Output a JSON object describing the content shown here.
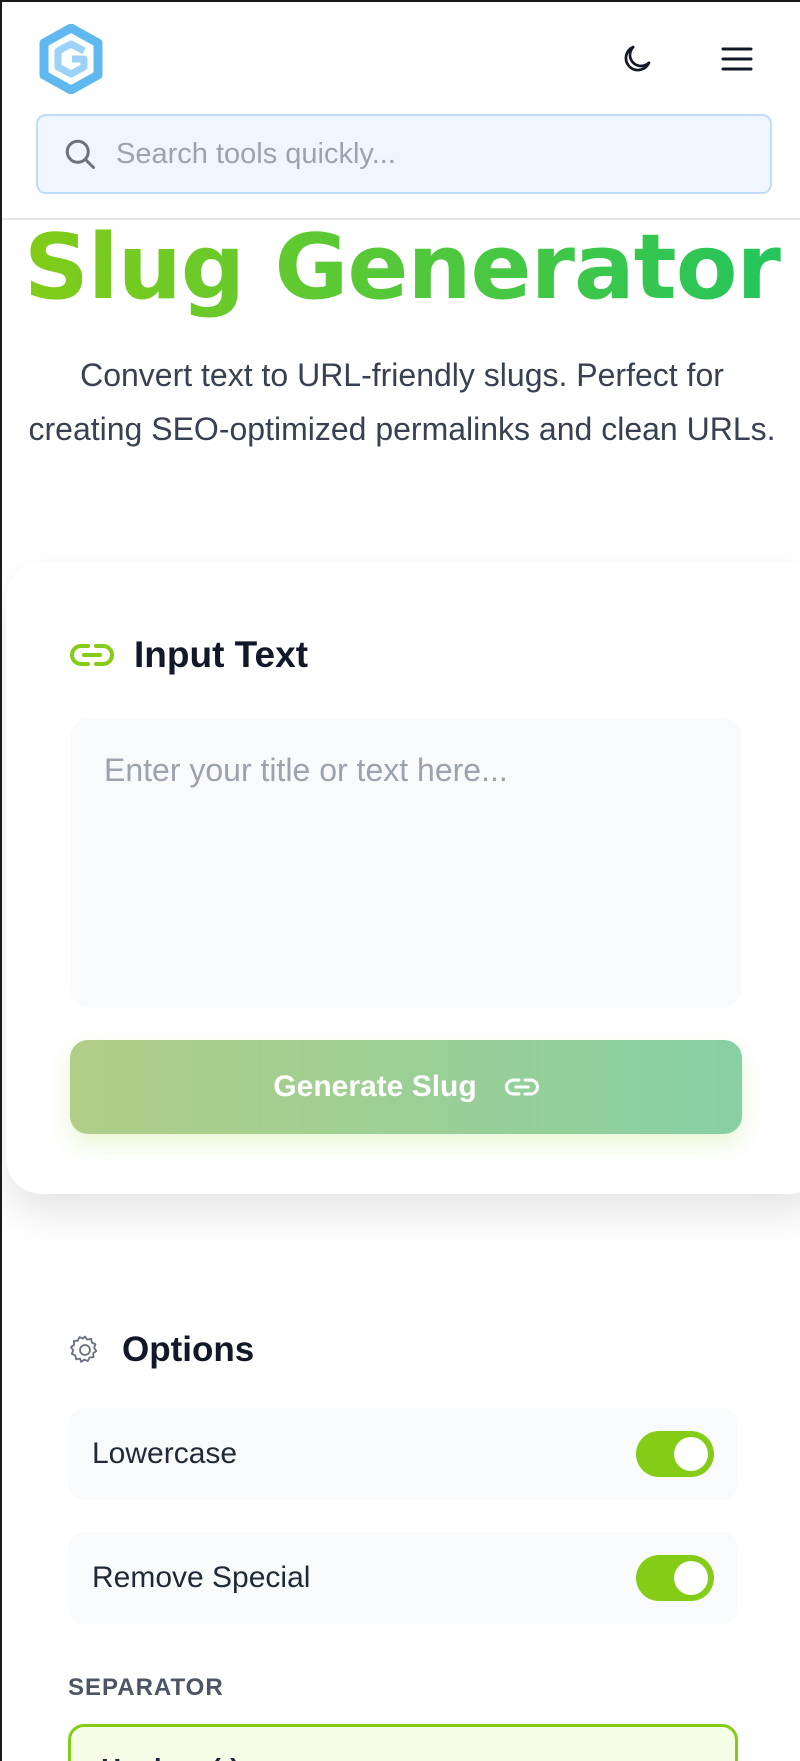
{
  "header": {
    "logo_icon": "hexagon-logo-icon",
    "theme_toggle_icon": "moon-icon",
    "menu_icon": "hamburger-menu-icon",
    "search": {
      "placeholder": "Search tools quickly...",
      "value": ""
    }
  },
  "hero": {
    "title": "Slug Generator",
    "subtitle": "Convert text to URL-friendly slugs. Perfect for creating SEO-optimized permalinks and clean URLs."
  },
  "input_card": {
    "heading": "Input Text",
    "heading_icon": "link-icon",
    "textarea": {
      "placeholder": "Enter your title or text here...",
      "value": ""
    },
    "generate_button": {
      "label": "Generate Slug",
      "icon": "link-icon"
    }
  },
  "options": {
    "heading": "Options",
    "heading_icon": "gear-icon",
    "toggles": [
      {
        "label": "Lowercase",
        "on": true
      },
      {
        "label": "Remove Special",
        "on": true
      }
    ],
    "separator": {
      "label": "SEPARATOR",
      "selected": "Hyphen (-)"
    }
  },
  "colors": {
    "accent": "#84cc16",
    "accent_green": "#22c55e",
    "logo_blue": "#60b8f0",
    "search_bg": "#eff6ff",
    "search_border": "#bfdbfe"
  }
}
